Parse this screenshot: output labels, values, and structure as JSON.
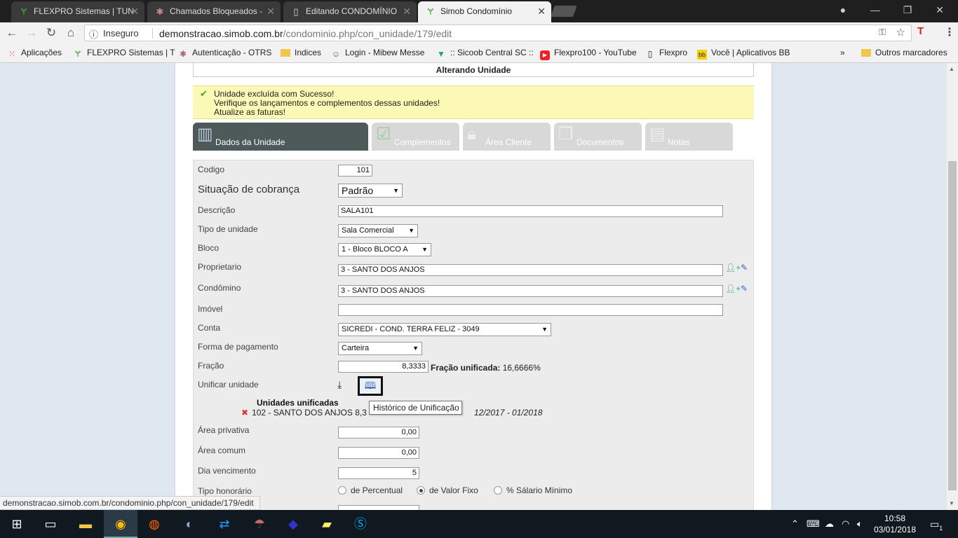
{
  "browser": {
    "tabs": [
      {
        "title": "FLEXPRO Sistemas | TUN",
        "icon": "flexpro-icon",
        "active": false
      },
      {
        "title": "Chamados Bloqueados -",
        "icon": "otrs-icon",
        "active": false
      },
      {
        "title": "Editando CONDOMÍNIO",
        "icon": "document-icon",
        "active": false
      },
      {
        "title": "Simob Condomínio",
        "icon": "flexpro-icon",
        "active": true
      }
    ],
    "address": {
      "security": "Inseguro",
      "host": "demonstracao.simob.com.br",
      "path": "/condominio.php/con_unidade/179/edit"
    },
    "bookmarks": [
      {
        "label": "Aplicações",
        "icon": "apps-grid-icon"
      },
      {
        "label": "FLEXPRO Sistemas | T",
        "icon": "flexpro-icon"
      },
      {
        "label": "Autenticação - OTRS",
        "icon": "otrs-icon"
      },
      {
        "label": "Indices",
        "icon": "folder-icon"
      },
      {
        "label": "Login - Mibew Messe",
        "icon": "chat-icon"
      },
      {
        "label": ":: Sicoob Central SC ::",
        "icon": "sicoob-icon"
      },
      {
        "label": "Flexpro100 - YouTube",
        "icon": "youtube-icon"
      },
      {
        "label": "Flexpro",
        "icon": "document-icon"
      },
      {
        "label": "Você | Aplicativos BB",
        "icon": "bb-icon"
      }
    ],
    "bookmarks_more": "»",
    "other_bookmarks": "Outros marcadores",
    "status_url": "demonstracao.simob.com.br/condominio.php/con_unidade/179/edit"
  },
  "page": {
    "title": "Alterando Unidade",
    "notice": [
      "Unidade excluída com Sucesso!",
      "Verifique os lançamentos e complementos dessas unidades!",
      "Atualize as faturas!"
    ],
    "tabs": [
      {
        "label": "Dados da Unidade",
        "icon": "building-icon",
        "active": true
      },
      {
        "label": "Complementos",
        "icon": "checklist-icon",
        "active": false
      },
      {
        "label": "Área Cliente",
        "icon": "lock-icon",
        "active": false
      },
      {
        "label": "Documentos",
        "icon": "documents-icon",
        "active": false
      },
      {
        "label": "Notas",
        "icon": "note-icon",
        "active": false
      }
    ],
    "form": {
      "codigo": {
        "label": "Codigo",
        "value": "101"
      },
      "situacao": {
        "label": "Situação de cobrança",
        "value": "Padrão"
      },
      "descricao": {
        "label": "Descrição",
        "value": "SALA101"
      },
      "tipo_unidade": {
        "label": "Tipo de unidade",
        "value": "Sala Comercial"
      },
      "bloco": {
        "label": "Bloco",
        "value": "1 - Bloco BLOCO A"
      },
      "proprietario": {
        "label": "Proprietario",
        "value": "3 - SANTO DOS ANJOS"
      },
      "condomino": {
        "label": "Condômino",
        "value": "3 - SANTO DOS ANJOS"
      },
      "imovel": {
        "label": "Imóvel",
        "value": ""
      },
      "conta": {
        "label": "Conta",
        "value": "SICREDI - COND. TERRA FELIZ - 3049"
      },
      "forma_pagamento": {
        "label": "Forma de pagamento",
        "value": "Carteira"
      },
      "fracao": {
        "label": "Fração",
        "value": "8,3333",
        "unificada_label": "Fração unificada:",
        "unificada_value": "16,6666%"
      },
      "unificar": {
        "label": "Unificar unidade",
        "tooltip": "Histórico de Unificação"
      },
      "unificadas": {
        "title": "Unidades unificadas",
        "rows": [
          {
            "text": "102 - SANTO DOS ANJOS 8,3",
            "period": "12/2017 - 01/2018"
          }
        ]
      },
      "area_privativa": {
        "label": "Área privativa",
        "value": "0,00"
      },
      "area_comum": {
        "label": "Área comum",
        "value": "0,00"
      },
      "dia_vencimento": {
        "label": "Dia vencimento",
        "value": "5"
      },
      "tipo_honorario": {
        "label": "Tipo honorário",
        "options": [
          {
            "label": "de Percentual",
            "checked": false
          },
          {
            "label": "de Valor Fixo",
            "checked": true
          },
          {
            "label": "% Sálario Mínimo",
            "checked": false
          }
        ]
      }
    }
  },
  "taskbar": {
    "time": "10:58",
    "date": "03/01/2018",
    "notifications": "1"
  }
}
